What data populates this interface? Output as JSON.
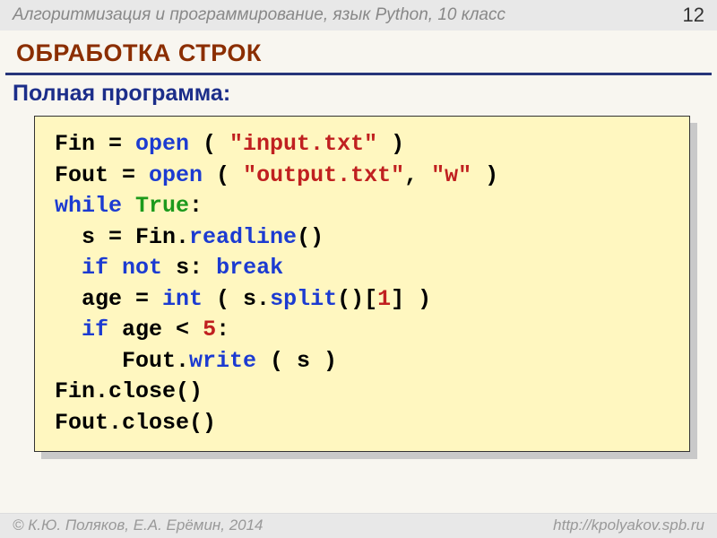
{
  "header": {
    "course": "Алгоритмизация и программирование, язык Python, 10 класс",
    "slide_number": "12"
  },
  "heading": "ОБРАБОТКА СТРОК",
  "subhead": "Полная программа:",
  "code_tokens": {
    "l1a": "Fin = ",
    "l1b": "open",
    "l1c": " ( ",
    "l1d": "\"input.txt\"",
    "l1e": " )",
    "l2a": "Fout = ",
    "l2b": "open",
    "l2c": " ( ",
    "l2d": "\"output.txt\"",
    "l2e": ", ",
    "l2f": "\"w\"",
    "l2g": " )",
    "l3a": "while",
    "l3b": " ",
    "l3c": "True",
    "l3d": ":",
    "l4a": "  s = Fin.",
    "l4b": "readline",
    "l4c": "()",
    "l5a": "  ",
    "l5b": "if",
    "l5c": " ",
    "l5d": "not",
    "l5e": " s: ",
    "l5f": "break",
    "l6a": "  age = ",
    "l6b": "int",
    "l6c": " ( s.",
    "l6d": "split",
    "l6e": "()[",
    "l6f": "1",
    "l6g": "] )",
    "l7a": "  ",
    "l7b": "if",
    "l7c": " age < ",
    "l7d": "5",
    "l7e": ":",
    "l8a": "     Fout.",
    "l8b": "write",
    "l8c": " ( s )",
    "l9a": "Fin.close()",
    "l10a": "Fout.close()"
  },
  "footer": {
    "left": "© К.Ю. Поляков, Е.А. Ерёмин, 2014",
    "right": "http://kpolyakov.spb.ru"
  }
}
